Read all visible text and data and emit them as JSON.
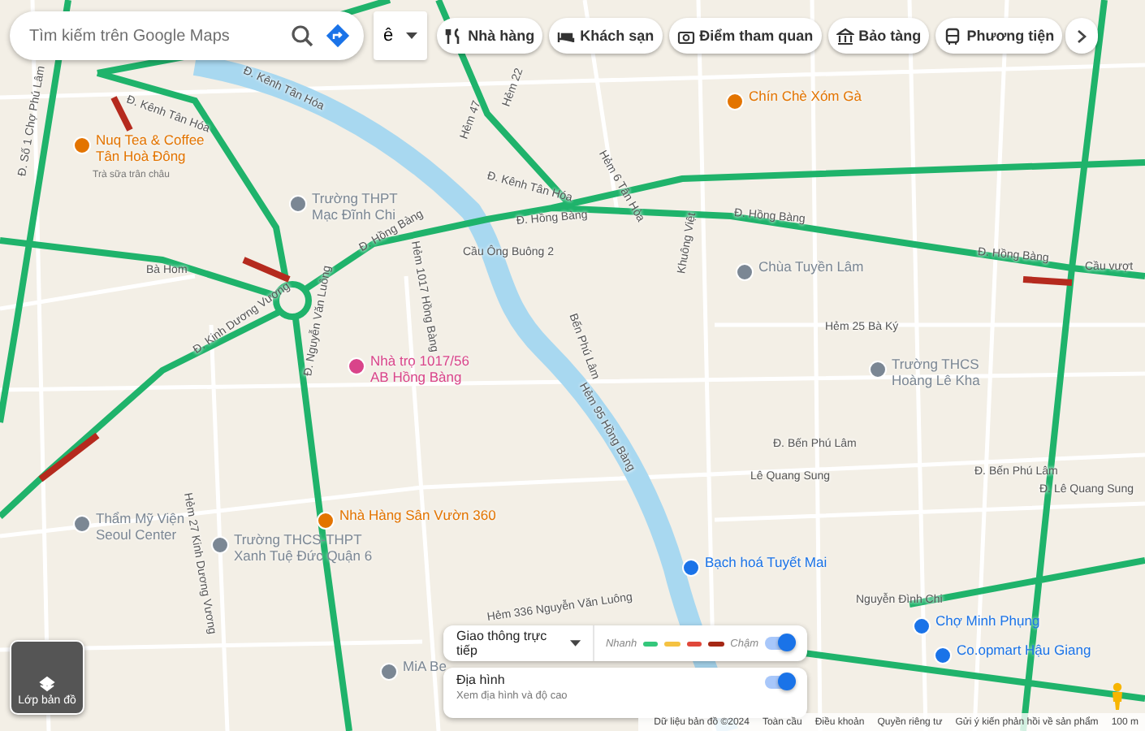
{
  "search": {
    "placeholder": "Tìm kiếm trên Google Maps"
  },
  "language_button": {
    "label": "ê"
  },
  "chips": [
    {
      "kind": "restaurant",
      "label": "Nhà hàng"
    },
    {
      "kind": "hotel",
      "label": "Khách sạn"
    },
    {
      "kind": "camera",
      "label": "Điểm tham quan"
    },
    {
      "kind": "museum",
      "label": "Bảo tàng"
    },
    {
      "kind": "transit",
      "label": "Phương tiện"
    }
  ],
  "streets": [
    "Đ. Kênh Tân Hóa",
    "Đ. Kênh Tân Hóa",
    "Hẻm 22",
    "Hẻm 47",
    "Hẻm 6 Tân Hòa",
    "Đ. Số 1 Chợ Phú Lâm",
    "Đ. Kênh Tân Hóa",
    "Đ. Hồng Bàng",
    "Đ. Hồng Bàng",
    "Đ. Hồng Bàng",
    "Hẻm 1017 Hồng Bàng",
    "Cầu Ông Buông 2",
    "Đ. Hồng Bàng",
    "Bà Hom",
    "Khuông Việt",
    "Cầu vượt",
    "Bến Phú Lâm",
    "Hẻm 25 Bà Ký",
    "Đ. Kinh Dương Vương",
    "Đ. Nguyễn Văn Luông",
    "Hẻm 95 Hồng Bàng",
    "Đ. Bến Phú Lâm",
    "Đ. Bến Phú Lâm",
    "Lê Quang Sung",
    "Đ. Lê Quang Sung",
    "Hẻm 27 Kinh Dương Vương",
    "Nguyễn Đình Chi",
    "Hẻm 336 Nguyễn Văn Luông"
  ],
  "places": [
    {
      "name": "Nuq Tea & Coffee\nTân Hoà Đông",
      "note": "Trà sữa trân châu",
      "color": "#e37400"
    },
    {
      "name": "Chín Chè Xóm Gà",
      "color": "#e37400"
    },
    {
      "name": "Trường THPT\nMạc Đĩnh Chi",
      "color": "#7b8794"
    },
    {
      "name": "Chùa Tuyền Lâm",
      "color": "#7b8794"
    },
    {
      "name": "Nhà trọ 1017/56\nAB Hồng Bàng",
      "color": "#d9448a"
    },
    {
      "name": "Trường THCS\nHoàng Lê Kha",
      "color": "#7b8794"
    },
    {
      "name": "Thẩm Mỹ Viện\nSeoul Center",
      "color": "#7b8794"
    },
    {
      "name": "Nhà Hàng Sân Vườn 360",
      "color": "#e37400"
    },
    {
      "name": "Bạch hoá Tuyết Mai",
      "color": "#1a73e8"
    },
    {
      "name": "Trường THCS-THPT\nXanh Tuệ Đức Quận 6",
      "color": "#7b8794"
    },
    {
      "name": "Chợ Minh Phụng",
      "color": "#1a73e8"
    },
    {
      "name": "Co.opmart Hậu Giang",
      "color": "#1a73e8"
    },
    {
      "name": "MiA Be",
      "color": "#7b8794"
    }
  ],
  "layers_button": {
    "label": "Lớp bản đồ"
  },
  "traffic": {
    "label": "Giao thông trực tiếp",
    "fast": "Nhanh",
    "slow": "Chậm",
    "legend": [
      {
        "color": "#34c77b"
      },
      {
        "color": "#f5c242"
      },
      {
        "color": "#e0473a"
      },
      {
        "color": "#a52714"
      }
    ],
    "on": true
  },
  "terrain": {
    "label": "Địa hình",
    "description": "Xem địa hình và độ cao",
    "on": true
  },
  "footer": [
    "Dữ liệu bản đồ ©2024",
    "Toàn cầu",
    "Điều khoản",
    "Quyền riêng tư",
    "Gửi ý kiến phản hồi về sản phẩm",
    "100 m"
  ]
}
